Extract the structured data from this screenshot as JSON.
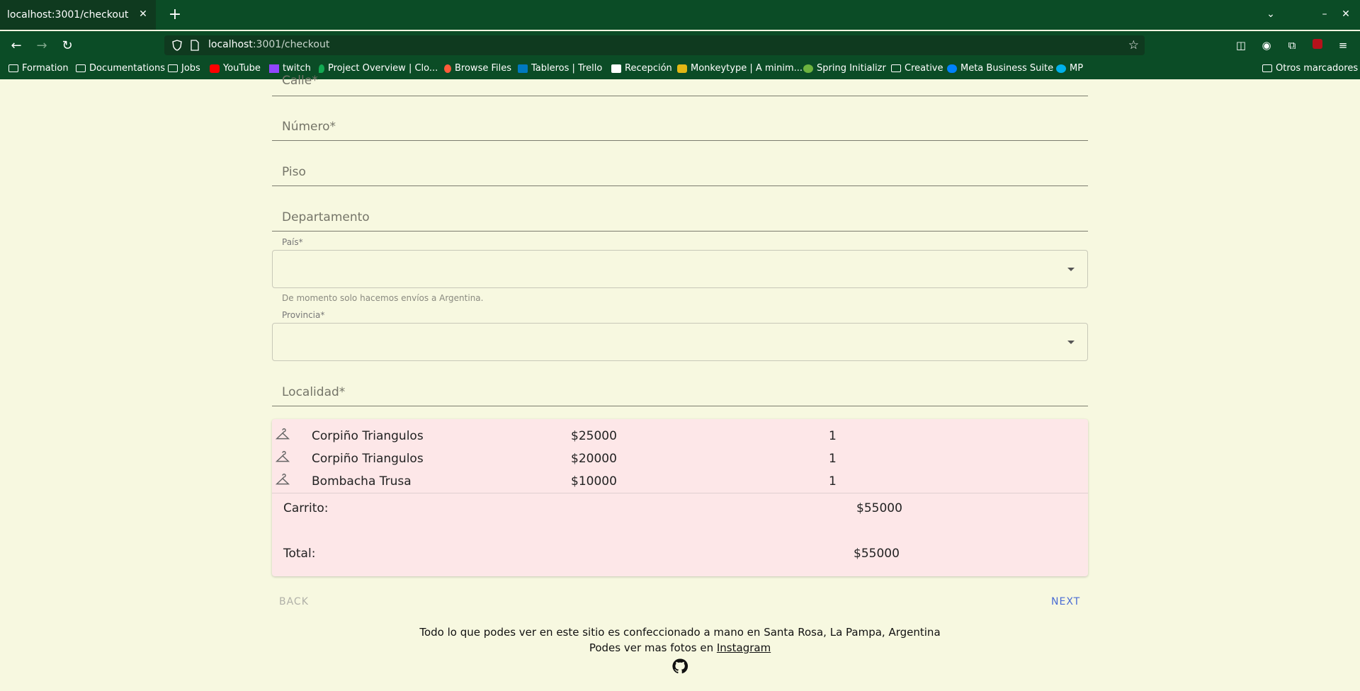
{
  "browser": {
    "tab_title": "localhost:3001/checkout",
    "tab_close": "✕",
    "new_tab": "+",
    "url_host": "localhost",
    "url_rest": ":3001/checkout",
    "bookmarks": [
      {
        "label": "Formation",
        "icon": "folder-icon"
      },
      {
        "label": "Documentations",
        "icon": "folder-icon"
      },
      {
        "label": "Jobs",
        "icon": "folder-icon"
      },
      {
        "label": "YouTube",
        "icon": "youtube-icon",
        "color": "#ff0000"
      },
      {
        "label": "twitch",
        "icon": "twitch-icon",
        "color": "#9146ff"
      },
      {
        "label": "Project Overview | Clo...",
        "icon": "mongodb-icon",
        "color": "#13aa52"
      },
      {
        "label": "Browse Files",
        "icon": "drop-icon",
        "color": "#ff5b3a"
      },
      {
        "label": "Tableros | Trello",
        "icon": "trello-icon",
        "color": "#0079bf"
      },
      {
        "label": "Recepción",
        "icon": "notion-icon",
        "color": "#ffffff"
      },
      {
        "label": "Monkeytype | A minim...",
        "icon": "monkeytype-icon",
        "color": "#e2b714"
      },
      {
        "label": "Spring Initializr",
        "icon": "spring-icon",
        "color": "#6db33f"
      },
      {
        "label": "Creative",
        "icon": "folder-icon"
      },
      {
        "label": "Meta Business Suite",
        "icon": "meta-icon",
        "color": "#0081fb"
      },
      {
        "label": "MP",
        "icon": "mercadopago-icon",
        "color": "#00b1ea"
      }
    ],
    "other_bookmarks": "Otros marcadores"
  },
  "form": {
    "calle_label": "Calle*",
    "numero_label": "Número*",
    "piso_label": "Piso",
    "departamento_label": "Departamento",
    "pais_label": "País*",
    "pais_helper": "De momento solo hacemos envíos a Argentina.",
    "provincia_label": "Provincia*",
    "localidad_label": "Localidad*"
  },
  "cart": {
    "items": [
      {
        "name": "Corpiño Triangulos",
        "price": "$25000",
        "qty": "1"
      },
      {
        "name": "Corpiño Triangulos",
        "price": "$20000",
        "qty": "1"
      },
      {
        "name": "Bombacha Trusa",
        "price": "$10000",
        "qty": "1"
      }
    ],
    "carrito_label": "Carrito:",
    "carrito_value": "$55000",
    "total_label": "Total:",
    "total_value": "$55000"
  },
  "actions": {
    "back_label": "BACK",
    "next_label": "NEXT"
  },
  "footer": {
    "line1": "Todo lo que podes ver en este sitio es confeccionado a mano en Santa Rosa, La Pampa, Argentina",
    "line2_prefix": "Podes ver mas fotos en ",
    "instagram_link": "Instagram"
  }
}
